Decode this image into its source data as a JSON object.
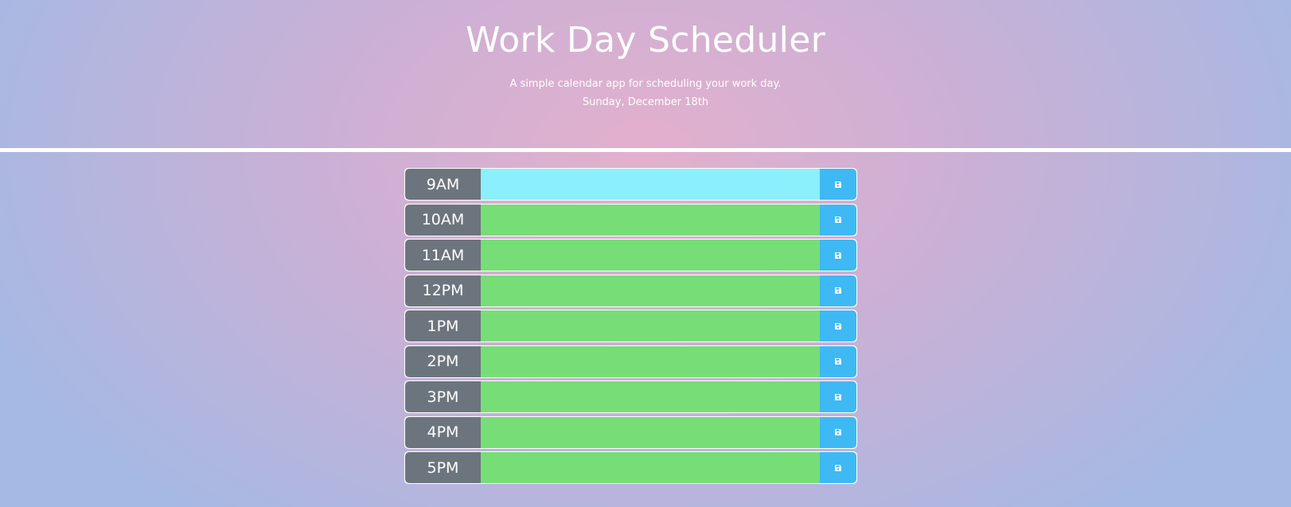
{
  "header": {
    "title": "Work Day Scheduler",
    "subtitle": "A simple calendar app for scheduling your work day.",
    "current_date": "Sunday, December 18th"
  },
  "colors": {
    "hour_block": "#6c757d",
    "present": "#8beffc",
    "future": "#77dd77",
    "save_button": "#3eb9f4"
  },
  "icons": {
    "save": "floppy-disk-icon"
  },
  "rows": [
    {
      "hour": "9AM",
      "state": "present",
      "text": ""
    },
    {
      "hour": "10AM",
      "state": "future",
      "text": ""
    },
    {
      "hour": "11AM",
      "state": "future",
      "text": ""
    },
    {
      "hour": "12PM",
      "state": "future",
      "text": ""
    },
    {
      "hour": "1PM",
      "state": "future",
      "text": ""
    },
    {
      "hour": "2PM",
      "state": "future",
      "text": ""
    },
    {
      "hour": "3PM",
      "state": "future",
      "text": ""
    },
    {
      "hour": "4PM",
      "state": "future",
      "text": ""
    },
    {
      "hour": "5PM",
      "state": "future",
      "text": ""
    }
  ]
}
